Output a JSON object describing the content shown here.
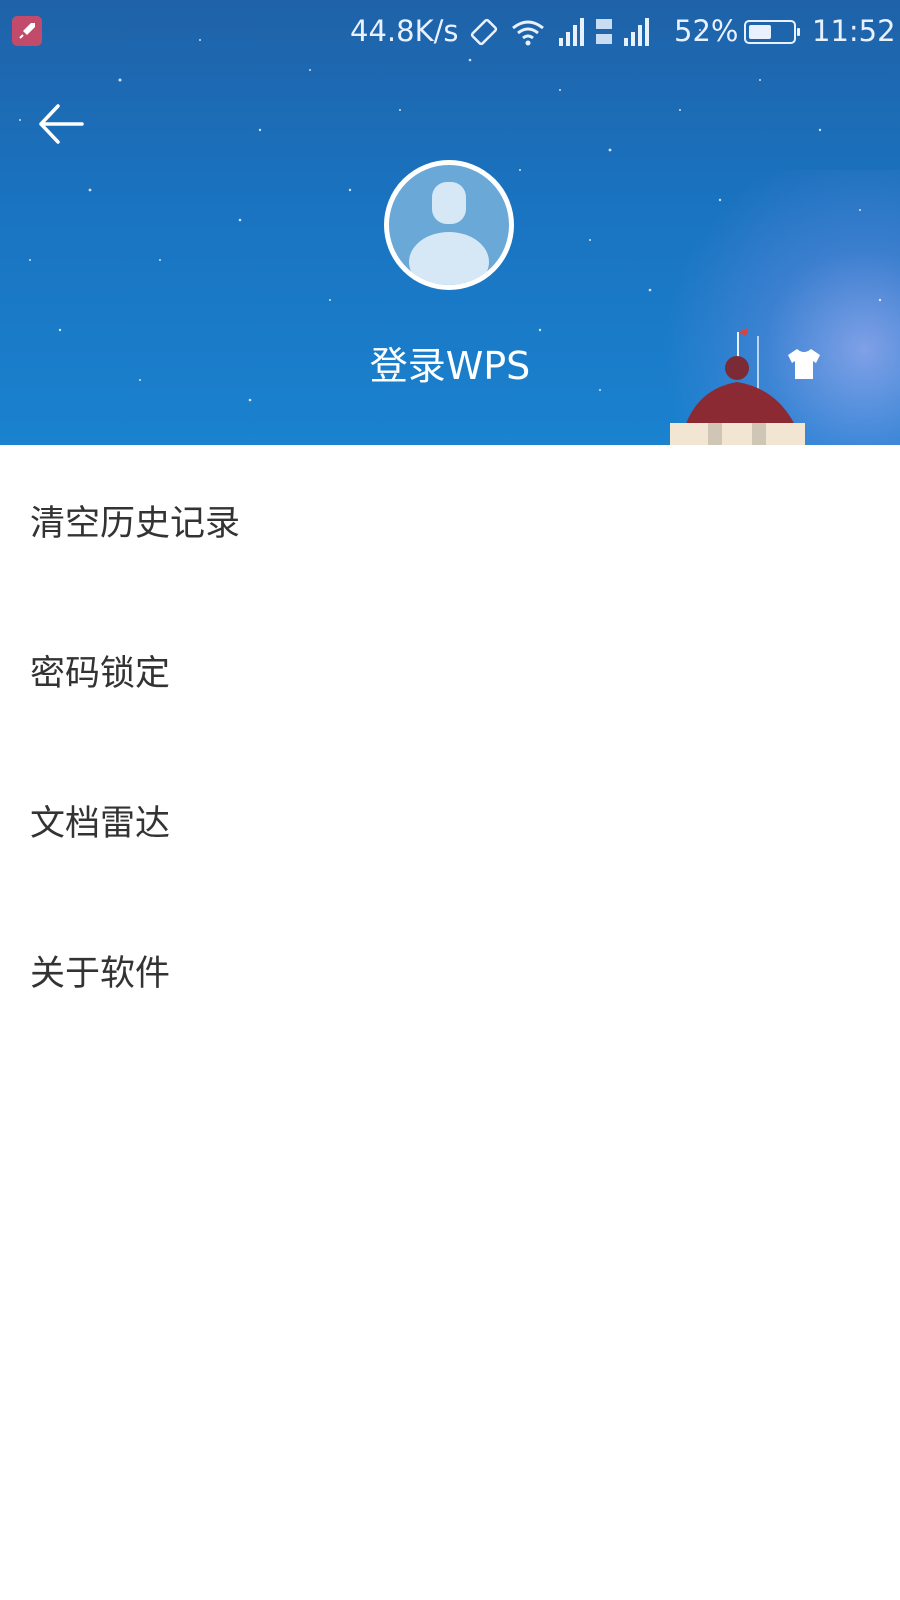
{
  "status_bar": {
    "net_speed": "44.8K/s",
    "battery_percent": "52%",
    "time": "11:52",
    "battery_level": 0.52,
    "icons": [
      "app-rocket-icon",
      "rotate-icon",
      "wifi-icon",
      "signal-icon",
      "network-4g-2g-icon",
      "battery-icon"
    ]
  },
  "header": {
    "back_icon": "arrow-left-icon",
    "login_label": "登录WPS",
    "skin_icon": "tshirt-icon"
  },
  "menu": {
    "items": [
      {
        "label": "清空历史记录"
      },
      {
        "label": "密码锁定"
      },
      {
        "label": "文档雷达"
      },
      {
        "label": "关于软件"
      }
    ]
  },
  "colors": {
    "header_top": "#1f62a8",
    "header_bottom": "#1a82cf",
    "menu_text": "#333333",
    "background": "#ffffff"
  }
}
